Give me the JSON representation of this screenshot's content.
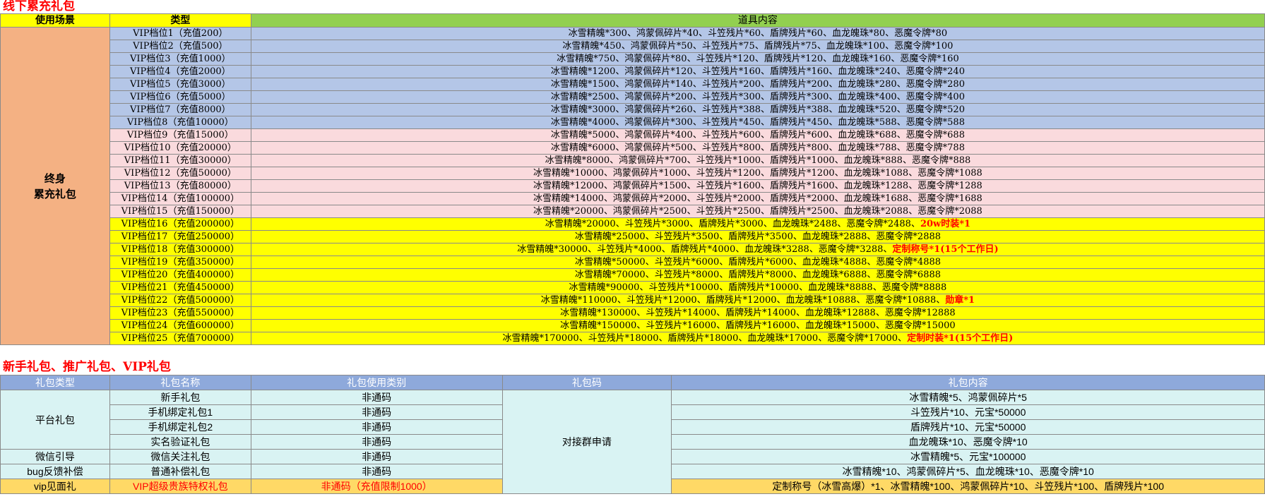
{
  "section1": {
    "title": "线下累充礼包",
    "headers": {
      "scene": "使用场景",
      "type": "类型",
      "items": "道具内容"
    },
    "scene_label_line1": "终身",
    "scene_label_line2": "累充礼包",
    "rows": [
      {
        "type": "VIP档位1（充值200）",
        "items": "冰雪精魄*300、鸿蒙佩碎片*40、斗笠残片*60、盾牌残片*60、血龙魄珠*80、恶魔令牌*80",
        "extra": "",
        "color": "blue"
      },
      {
        "type": "VIP档位2（充值500）",
        "items": "冰雪精魄*450、鸿蒙佩碎片*50、斗笠残片*75、盾牌残片*75、血龙魄珠*100、恶魔令牌*100",
        "extra": "",
        "color": "blue"
      },
      {
        "type": "VIP档位3（充值1000）",
        "items": "冰雪精魄*750、鸿蒙佩碎片*80、斗笠残片*120、盾牌残片*120、血龙魄珠*160、恶魔令牌*160",
        "extra": "",
        "color": "blue"
      },
      {
        "type": "VIP档位4（充值2000）",
        "items": "冰雪精魄*1200、鸿蒙佩碎片*120、斗笠残片*160、盾牌残片*160、血龙魄珠*240、恶魔令牌*240",
        "extra": "",
        "color": "blue"
      },
      {
        "type": "VIP档位5（充值3000）",
        "items": "冰雪精魄*1500、鸿蒙佩碎片*140、斗笠残片*200、盾牌残片*200、血龙魄珠*280、恶魔令牌*280",
        "extra": "",
        "color": "blue"
      },
      {
        "type": "VIP档位6（充值5000）",
        "items": "冰雪精魄*2500、鸿蒙佩碎片*200、斗笠残片*300、盾牌残片*300、血龙魄珠*400、恶魔令牌*400",
        "extra": "",
        "color": "blue"
      },
      {
        "type": "VIP档位7（充值8000）",
        "items": "冰雪精魄*3000、鸿蒙佩碎片*260、斗笠残片*388、盾牌残片*388、血龙魄珠*520、恶魔令牌*520",
        "extra": "",
        "color": "blue"
      },
      {
        "type": "VIP档位8（充值10000）",
        "items": "冰雪精魄*4000、鸿蒙佩碎片*300、斗笠残片*450、盾牌残片*450、血龙魄珠*588、恶魔令牌*588",
        "extra": "",
        "color": "blue"
      },
      {
        "type": "VIP档位9（充值15000）",
        "items": "冰雪精魄*5000、鸿蒙佩碎片*400、斗笠残片*600、盾牌残片*600、血龙魄珠*688、恶魔令牌*688",
        "extra": "",
        "color": "pink"
      },
      {
        "type": "VIP档位10（充值20000）",
        "items": "冰雪精魄*6000、鸿蒙佩碎片*500、斗笠残片*800、盾牌残片*800、血龙魄珠*788、恶魔令牌*788",
        "extra": "",
        "color": "pink"
      },
      {
        "type": "VIP档位11（充值30000）",
        "items": "冰雪精魄*8000、鸿蒙佩碎片*700、斗笠残片*1000、盾牌残片*1000、血龙魄珠*888、恶魔令牌*888",
        "extra": "",
        "color": "pink"
      },
      {
        "type": "VIP档位12（充值50000）",
        "items": "冰雪精魄*10000、鸿蒙佩碎片*1000、斗笠残片*1200、盾牌残片*1200、血龙魄珠*1088、恶魔令牌*1088",
        "extra": "",
        "color": "pink"
      },
      {
        "type": "VIP档位13（充值80000）",
        "items": "冰雪精魄*12000、鸿蒙佩碎片*1500、斗笠残片*1600、盾牌残片*1600、血龙魄珠*1288、恶魔令牌*1288",
        "extra": "",
        "color": "pink"
      },
      {
        "type": "VIP档位14（充值100000）",
        "items": "冰雪精魄*14000、鸿蒙佩碎片*2000、斗笠残片*2000、盾牌残片*2000、血龙魄珠*1688、恶魔令牌*1688",
        "extra": "",
        "color": "pink"
      },
      {
        "type": "VIP档位15（充值150000）",
        "items": "冰雪精魄*20000、鸿蒙佩碎片*2500、斗笠残片*2500、盾牌残片*2500、血龙魄珠*2088、恶魔令牌*2088",
        "extra": "",
        "color": "pink"
      },
      {
        "type": "VIP档位16（充值200000）",
        "items": "冰雪精魄*20000、斗笠残片*3000、盾牌残片*3000、血龙魄珠*2488、恶魔令牌*2488、",
        "extra": "20w时装*1",
        "color": "yellow"
      },
      {
        "type": "VIP档位17（充值250000）",
        "items": "冰雪精魄*25000、斗笠残片*3500、盾牌残片*3500、血龙魄珠*2888、恶魔令牌*2888",
        "extra": "",
        "color": "yellow"
      },
      {
        "type": "VIP档位18（充值300000）",
        "items": "冰雪精魄*30000、斗笠残片*4000、盾牌残片*4000、血龙魄珠*3288、恶魔令牌*3288、",
        "extra": "定制称号*1(15个工作日)",
        "color": "yellow"
      },
      {
        "type": "VIP档位19（充值350000）",
        "items": "冰雪精魄*50000、斗笠残片*6000、盾牌残片*6000、血龙魄珠*4888、恶魔令牌*4888",
        "extra": "",
        "color": "yellow"
      },
      {
        "type": "VIP档位20（充值400000）",
        "items": "冰雪精魄*70000、斗笠残片*8000、盾牌残片*8000、血龙魄珠*6888、恶魔令牌*6888",
        "extra": "",
        "color": "yellow"
      },
      {
        "type": "VIP档位21（充值450000）",
        "items": "冰雪精魄*90000、斗笠残片*10000、盾牌残片*10000、血龙魄珠*8888、恶魔令牌*8888",
        "extra": "",
        "color": "yellow"
      },
      {
        "type": "VIP档位22（充值500000）",
        "items": "冰雪精魄*110000、斗笠残片*12000、盾牌残片*12000、血龙魄珠*10888、恶魔令牌*10888、",
        "extra": "勋章*1",
        "color": "yellow"
      },
      {
        "type": "VIP档位23（充值550000）",
        "items": "冰雪精魄*130000、斗笠残片*14000、盾牌残片*14000、血龙魄珠*12888、恶魔令牌*12888",
        "extra": "",
        "color": "yellow"
      },
      {
        "type": "VIP档位24（充值600000）",
        "items": "冰雪精魄*150000、斗笠残片*16000、盾牌残片*16000、血龙魄珠*15000、恶魔令牌*15000",
        "extra": "",
        "color": "yellow"
      },
      {
        "type": "VIP档位25（充值700000）",
        "items": "冰雪精魄*170000、斗笠残片*18000、盾牌残片*18000、血龙魄珠*17000、恶魔令牌*17000、",
        "extra": "定制时装*1(15个工作日)",
        "color": "yellow"
      }
    ]
  },
  "section2": {
    "title": "新手礼包、推广礼包、VIP礼包",
    "headers": {
      "category": "礼包类型",
      "name": "礼包名称",
      "usage": "礼包使用类别",
      "code": "礼包码",
      "content": "礼包内容"
    },
    "code_merged": "对接群申请",
    "categories": {
      "platform": "平台礼包",
      "wechat": "微信引导",
      "bug": "bug反馈补偿",
      "vip": "vip见面礼"
    },
    "rows": [
      {
        "name": "新手礼包",
        "usage": "非通码",
        "content": "冰雪精魄*5、鸿蒙佩碎片*5"
      },
      {
        "name": "手机绑定礼包1",
        "usage": "非通码",
        "content": "斗笠残片*10、元宝*50000"
      },
      {
        "name": "手机绑定礼包2",
        "usage": "非通码",
        "content": "盾牌残片*10、元宝*50000"
      },
      {
        "name": "实名验证礼包",
        "usage": "非通码",
        "content": "血龙魄珠*10、恶魔令牌*10"
      },
      {
        "name": "微信关注礼包",
        "usage": "非通码",
        "content": "冰雪精魄*5、元宝*100000"
      },
      {
        "name": "普通补偿礼包",
        "usage": "非通码",
        "content": "冰雪精魄*10、鸿蒙佩碎片*5、血龙魄珠*10、恶魔令牌*10"
      },
      {
        "name": "VIP超级贵族特权礼包",
        "usage": "非通码（充值限制1000）",
        "content": "定制称号（冰雪高爆）*1、冰雪精魄*100、鸿蒙佩碎片*10、斗笠残片*100、盾牌残片*100"
      }
    ]
  }
}
